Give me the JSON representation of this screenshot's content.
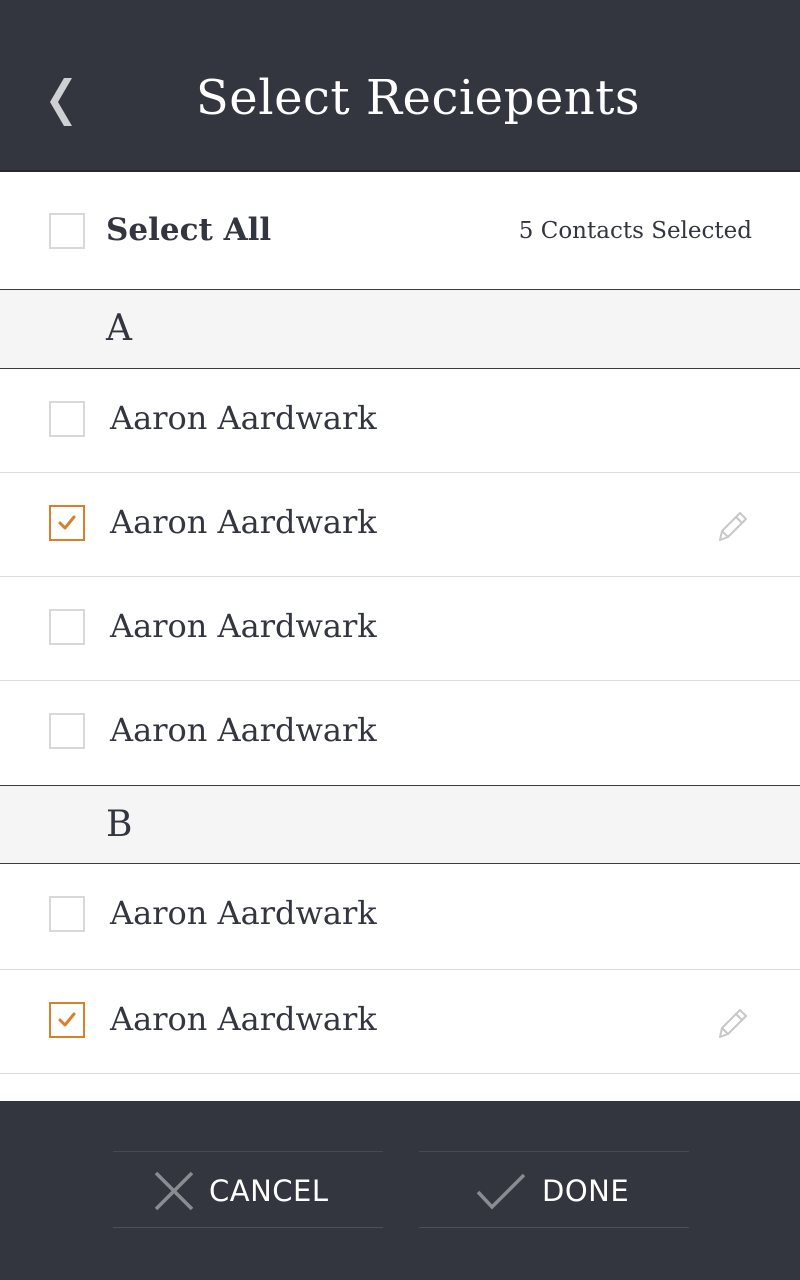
{
  "header": {
    "title": "Select Reciepents",
    "back_icon": "chevron-left-icon"
  },
  "select_all": {
    "label": "Select All",
    "checked": false,
    "selected_count_text": "5 Contacts Selected"
  },
  "sections": [
    {
      "letter": "A",
      "contacts": [
        {
          "name": "Aaron Aardwark",
          "checked": false,
          "editable": false
        },
        {
          "name": "Aaron Aardwark",
          "checked": true,
          "editable": true
        },
        {
          "name": "Aaron Aardwark",
          "checked": false,
          "editable": false
        },
        {
          "name": "Aaron Aardwark",
          "checked": false,
          "editable": false
        }
      ]
    },
    {
      "letter": "B",
      "contacts": [
        {
          "name": "Aaron Aardwark",
          "checked": false,
          "editable": false
        },
        {
          "name": "Aaron Aardwark",
          "checked": true,
          "editable": true
        }
      ]
    }
  ],
  "footer": {
    "cancel_label": "CANCEL",
    "cancel_icon": "close-icon",
    "done_label": "DONE",
    "done_icon": "checkmark-icon"
  },
  "colors": {
    "header_bg": "#33363f",
    "accent": "#d9802a",
    "text": "#33353f",
    "section_bg": "#f5f5f5"
  }
}
